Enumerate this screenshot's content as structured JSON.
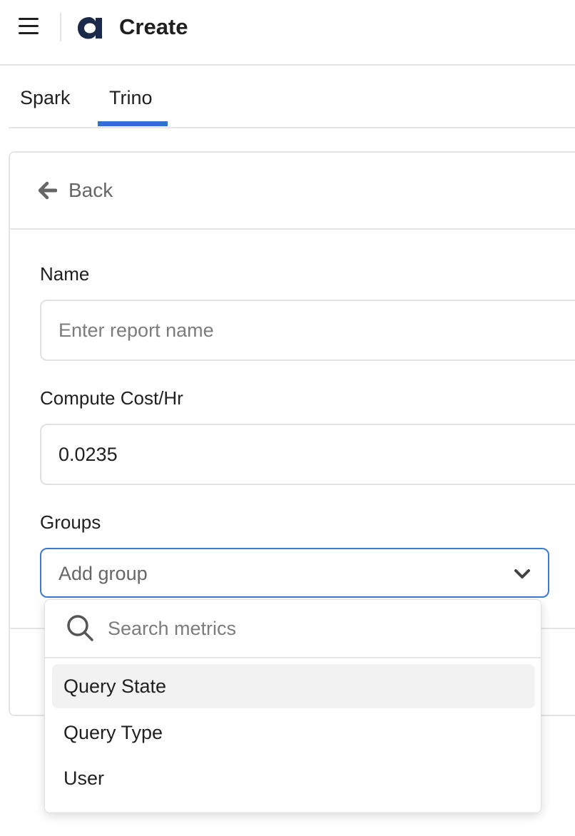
{
  "header": {
    "menu_icon": "hamburger-menu-icon",
    "logo_icon": "app-logo-icon",
    "title": "Create"
  },
  "tabs": [
    {
      "label": "Spark",
      "active": false
    },
    {
      "label": "Trino",
      "active": true
    }
  ],
  "accent_color": "#2f6fd6",
  "form": {
    "back_label": "Back",
    "name": {
      "label": "Name",
      "placeholder": "Enter report name",
      "value": ""
    },
    "compute_cost": {
      "label": "Compute Cost/Hr",
      "value": "0.0235"
    },
    "groups": {
      "label": "Groups",
      "placeholder": "Add group"
    }
  },
  "dropdown": {
    "search_placeholder": "Search metrics",
    "options": [
      "Query State",
      "Query Type",
      "User"
    ]
  }
}
